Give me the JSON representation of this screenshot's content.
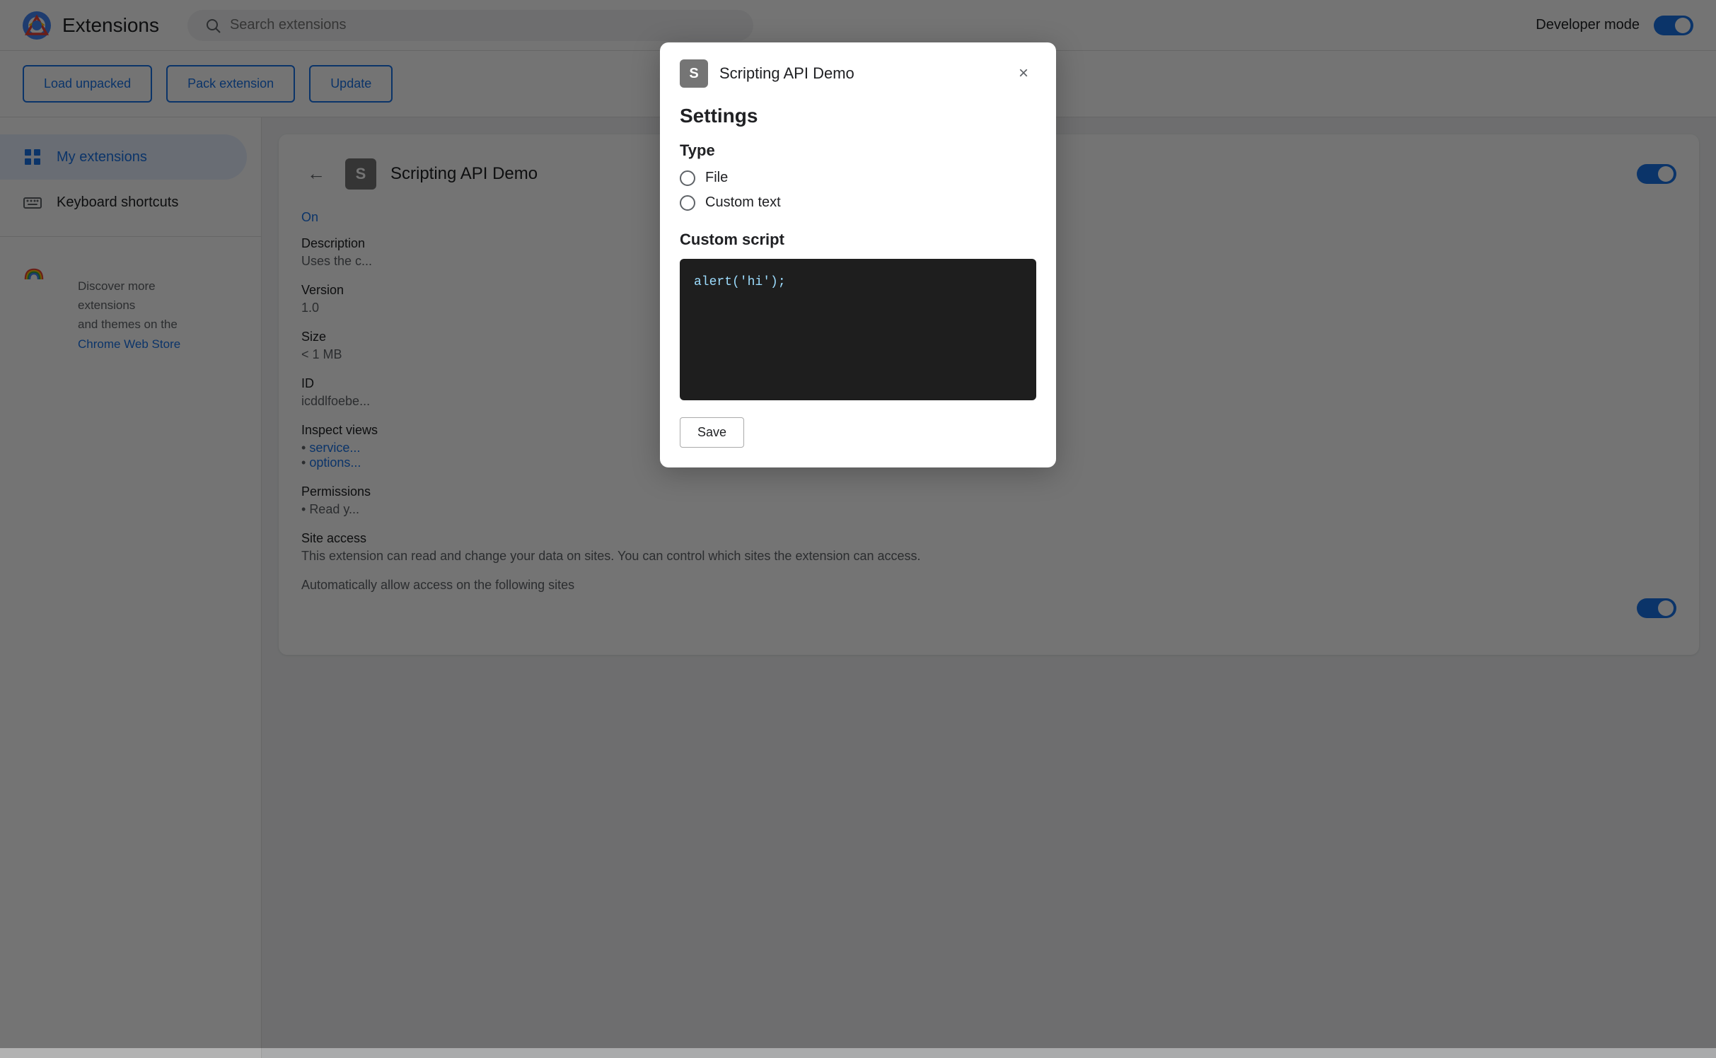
{
  "app": {
    "title": "Extensions",
    "logo_alt": "Chrome logo"
  },
  "search": {
    "placeholder": "Search extensions",
    "value": ""
  },
  "developer_mode": {
    "label": "Developer mode",
    "enabled": true
  },
  "toolbar": {
    "load_unpacked": "Load unpacked",
    "pack_extension": "Pack extension",
    "update": "Update"
  },
  "sidebar": {
    "items": [
      {
        "label": "My extensions",
        "active": true,
        "icon": "puzzle-icon"
      },
      {
        "label": "Keyboard shortcuts",
        "active": false,
        "icon": "keyboard-icon"
      }
    ],
    "discover_text_1": "Discover more extensions",
    "discover_text_2": "and themes on the ",
    "discover_link": "Chrome Web Store"
  },
  "extension_detail": {
    "back_label": "←",
    "icon_letter": "S",
    "name": "Scripting API Demo",
    "on_label": "On",
    "toggle_enabled": true,
    "description_label": "Description",
    "description_value": "Uses the c...",
    "version_label": "Version",
    "version_value": "1.0",
    "size_label": "Size",
    "size_value": "< 1 MB",
    "id_label": "ID",
    "id_value": "icddlfoebe...",
    "inspect_label": "Inspect views",
    "service_link": "service...",
    "options_link": "options...",
    "permissions_label": "Permissions",
    "permissions_value": "Read y...",
    "site_access_label": "Site access",
    "site_access_desc": "This extension can read and change your data on sites. You can control which sites the extension can access.",
    "auto_allow_label": "Automatically allow access on the following sites"
  },
  "modal": {
    "icon_letter": "S",
    "title": "Scripting API Demo",
    "close_label": "×",
    "settings_heading": "Settings",
    "type_heading": "Type",
    "type_options": [
      "File",
      "Custom text"
    ],
    "custom_script_heading": "Custom script",
    "code_content": "alert('hi');",
    "save_label": "Save"
  },
  "colors": {
    "accent": "#1a73e8",
    "text_primary": "#202124",
    "text_secondary": "#5f6368",
    "bg_sidebar_active": "#e8f0fe",
    "code_bg": "#1e1e1e"
  }
}
